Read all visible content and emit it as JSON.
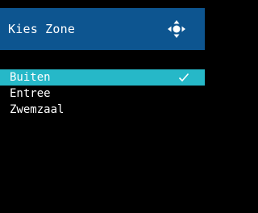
{
  "colors": {
    "background": "#000000",
    "header_background": "#0d5590",
    "header_text": "#ffffff",
    "selected_background": "#26b8c8",
    "item_text": "#ffffff"
  },
  "header": {
    "title": "Kies Zone",
    "icon": "move-arrows-icon"
  },
  "zones": [
    {
      "label": "Buiten",
      "selected": true,
      "icon": "checkmark-icon"
    },
    {
      "label": "Entree",
      "selected": false
    },
    {
      "label": "Zwemzaal",
      "selected": false
    }
  ]
}
